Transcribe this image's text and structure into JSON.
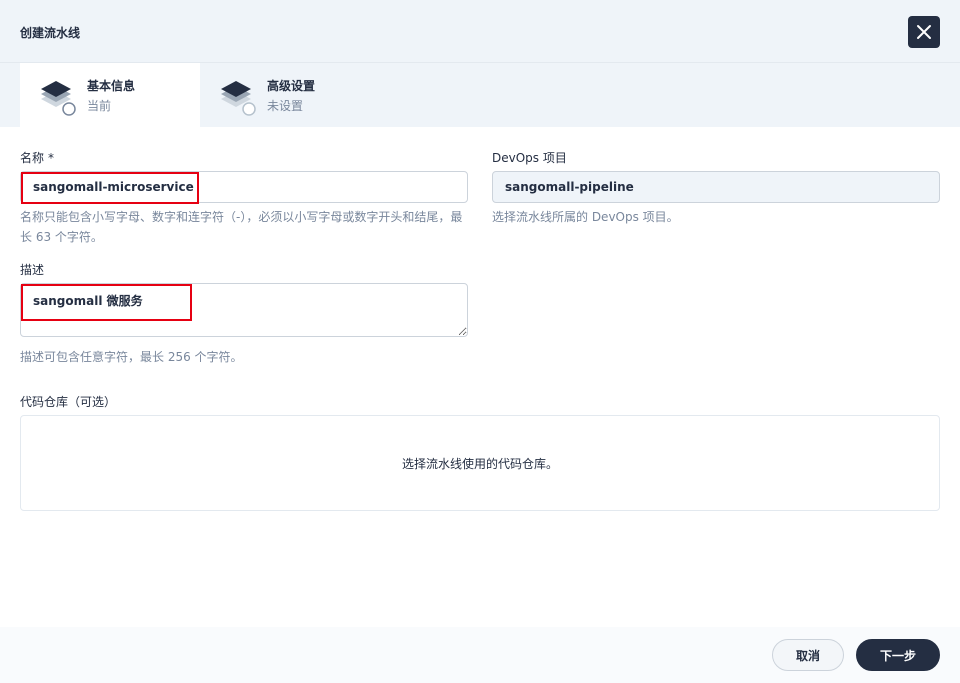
{
  "dialog": {
    "title": "创建流水线"
  },
  "tabs": [
    {
      "title": "基本信息",
      "status": "当前",
      "icon": "layers-icon"
    },
    {
      "title": "高级设置",
      "status": "未设置",
      "icon": "layers-icon"
    }
  ],
  "form": {
    "name": {
      "label": "名称",
      "required_mark": "*",
      "value": "sangomall-microservice",
      "help": "名称只能包含小写字母、数字和连字符（-），必须以小写字母或数字开头和结尾，最长 63 个字符。"
    },
    "project": {
      "label": "DevOps 项目",
      "value": "sangomall-pipeline",
      "help": "选择流水线所属的 DevOps 项目。"
    },
    "description": {
      "label": "描述",
      "value": "sangomall 微服务",
      "help": "描述可包含任意字符，最长 256 个字符。"
    },
    "repo": {
      "label": "代码仓库（可选）",
      "placeholder": "选择流水线使用的代码仓库。"
    }
  },
  "footer": {
    "cancel_label": "取消",
    "next_label": "下一步"
  },
  "colors": {
    "primary_dark": "#242e42",
    "highlight_red": "#e60012",
    "muted_text": "#79879c",
    "panel_bg": "#eff4f9"
  }
}
